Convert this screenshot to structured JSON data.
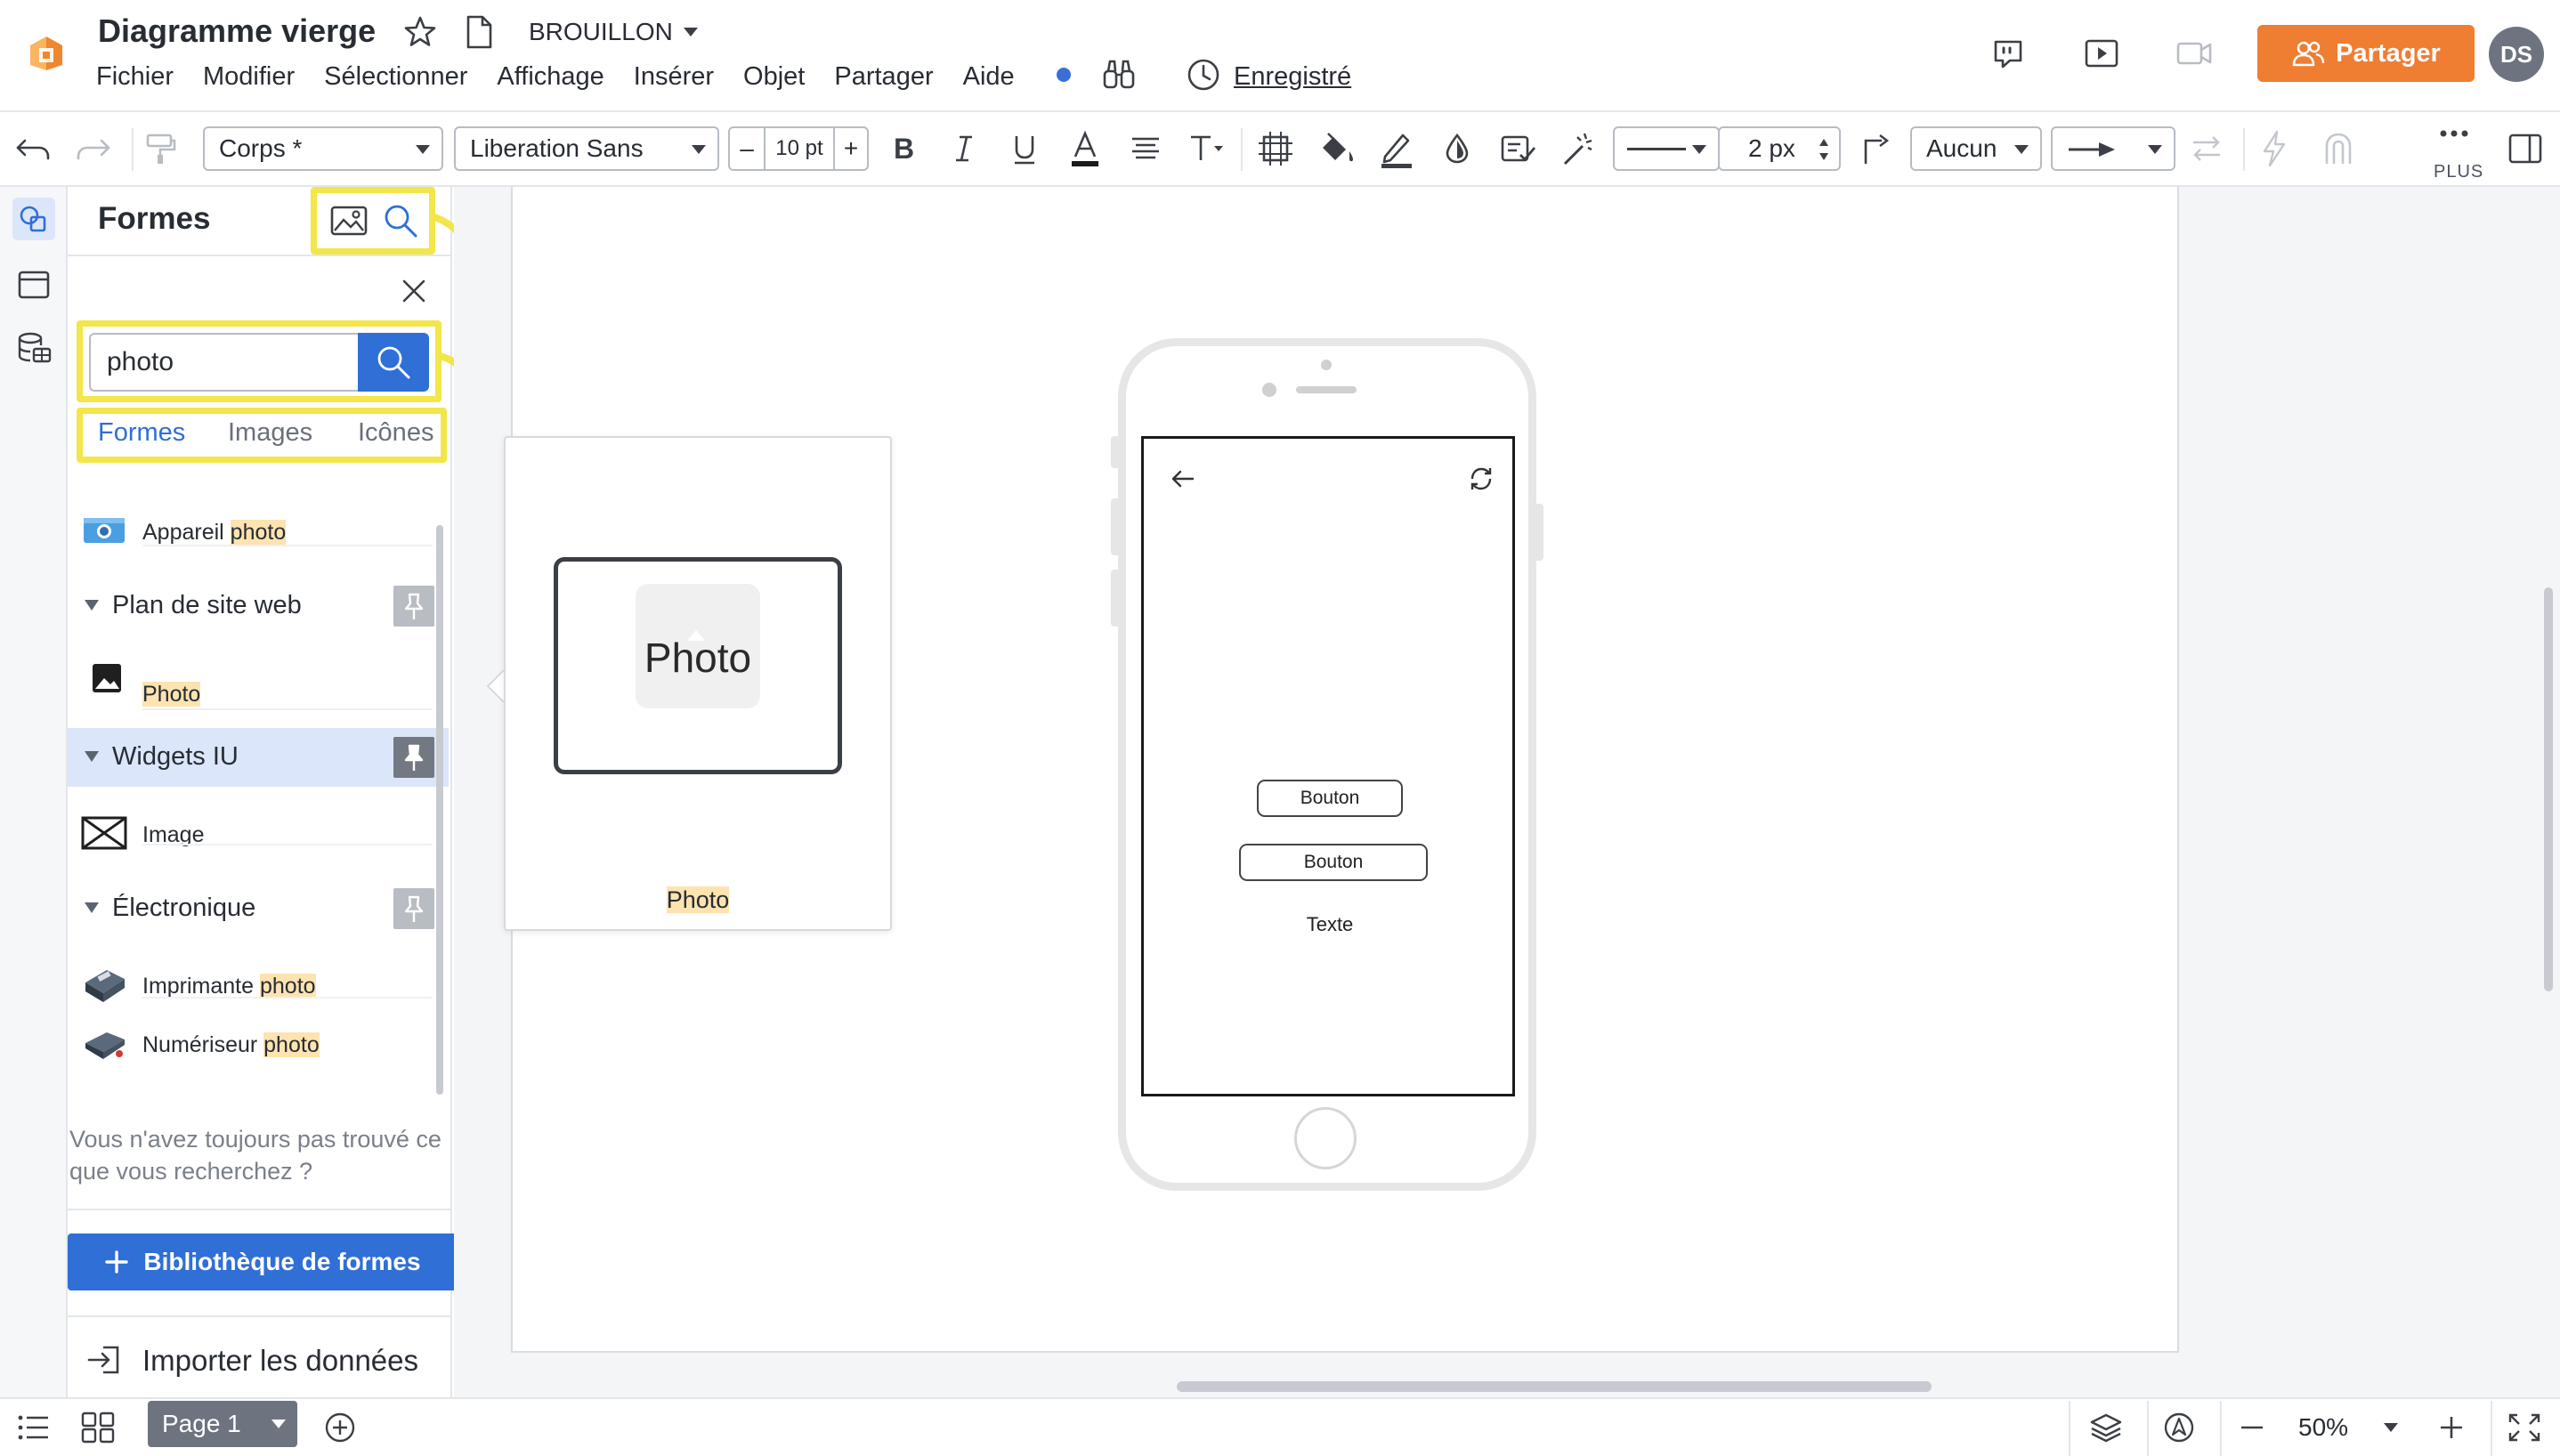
{
  "header": {
    "title": "Diagramme vierge",
    "status": "BROUILLON",
    "menu": [
      "Fichier",
      "Modifier",
      "Sélectionner",
      "Affichage",
      "Insérer",
      "Objet",
      "Partager",
      "Aide"
    ],
    "saved_label": "Enregistré",
    "share_label": "Partager",
    "avatar_initials": "DS"
  },
  "toolbar": {
    "style_value": "Corps *",
    "font_value": "Liberation Sans",
    "font_size_minus": "–",
    "font_size": "10 pt",
    "font_size_plus": "+",
    "line_width": "2 px",
    "arrow_start": "Aucun",
    "more_label": "PLUS"
  },
  "panel": {
    "title": "Formes",
    "search_value": "photo",
    "tabs": [
      "Formes",
      "Images",
      "Icônes"
    ],
    "results": [
      {
        "prefix": "Appareil ",
        "highlight": "photo",
        "icon": "camera-icon"
      },
      {
        "group": "Plan de site web",
        "pinned": false
      },
      {
        "prefix": "",
        "highlight": "Photo",
        "icon": "photo-icon"
      },
      {
        "group": "Widgets IU",
        "pinned": true
      },
      {
        "prefix": "Image",
        "highlight": "",
        "icon": "image-placeholder-icon"
      },
      {
        "group": "Électronique",
        "pinned": false
      },
      {
        "prefix": "Imprimante ",
        "highlight": "photo",
        "icon": "printer-icon"
      },
      {
        "prefix": "Numériseur ",
        "highlight": "photo",
        "icon": "scanner-icon"
      }
    ],
    "not_found": "Vous n'avez toujours pas trouvé ce que vous recherchez ?",
    "library_button": "Bibliothèque de formes",
    "import_label": "Importer les données"
  },
  "preview": {
    "shape_text": "Photo",
    "label": "Photo"
  },
  "canvas": {
    "buttons": [
      "Bouton",
      "Bouton"
    ],
    "text": "Texte"
  },
  "bottom": {
    "page_label": "Page 1",
    "zoom": "50%"
  },
  "colors": {
    "accent": "#2f6fd6",
    "share": "#ef7d32",
    "highlight_box": "#f2e64a",
    "match_highlight": "#fde3b0"
  }
}
